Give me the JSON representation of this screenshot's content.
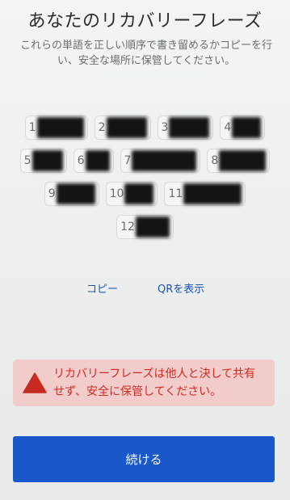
{
  "header": {
    "title": "あなたのリカバリーフレーズ",
    "description": "これらの単語を正しい順序で書き留めるかコピーを行い、安全な場所に保管してください。"
  },
  "recovery_words": [
    {
      "number": "1"
    },
    {
      "number": "2"
    },
    {
      "number": "3"
    },
    {
      "number": "4"
    },
    {
      "number": "5"
    },
    {
      "number": "6"
    },
    {
      "number": "7"
    },
    {
      "number": "8"
    },
    {
      "number": "9"
    },
    {
      "number": "10"
    },
    {
      "number": "11"
    },
    {
      "number": "12"
    }
  ],
  "actions": {
    "copy_label": "コピー",
    "show_qr_label": "QRを表示",
    "link_color": "#1b55b8"
  },
  "warning": {
    "icon": "warning-triangle-icon",
    "text": "リカバリーフレーズは他人と決して共有せず、安全に保管してください。",
    "background": "#f1cccb",
    "text_color": "#cf2b22"
  },
  "footer": {
    "continue_label": "続ける",
    "button_color": "#1a57c9"
  }
}
